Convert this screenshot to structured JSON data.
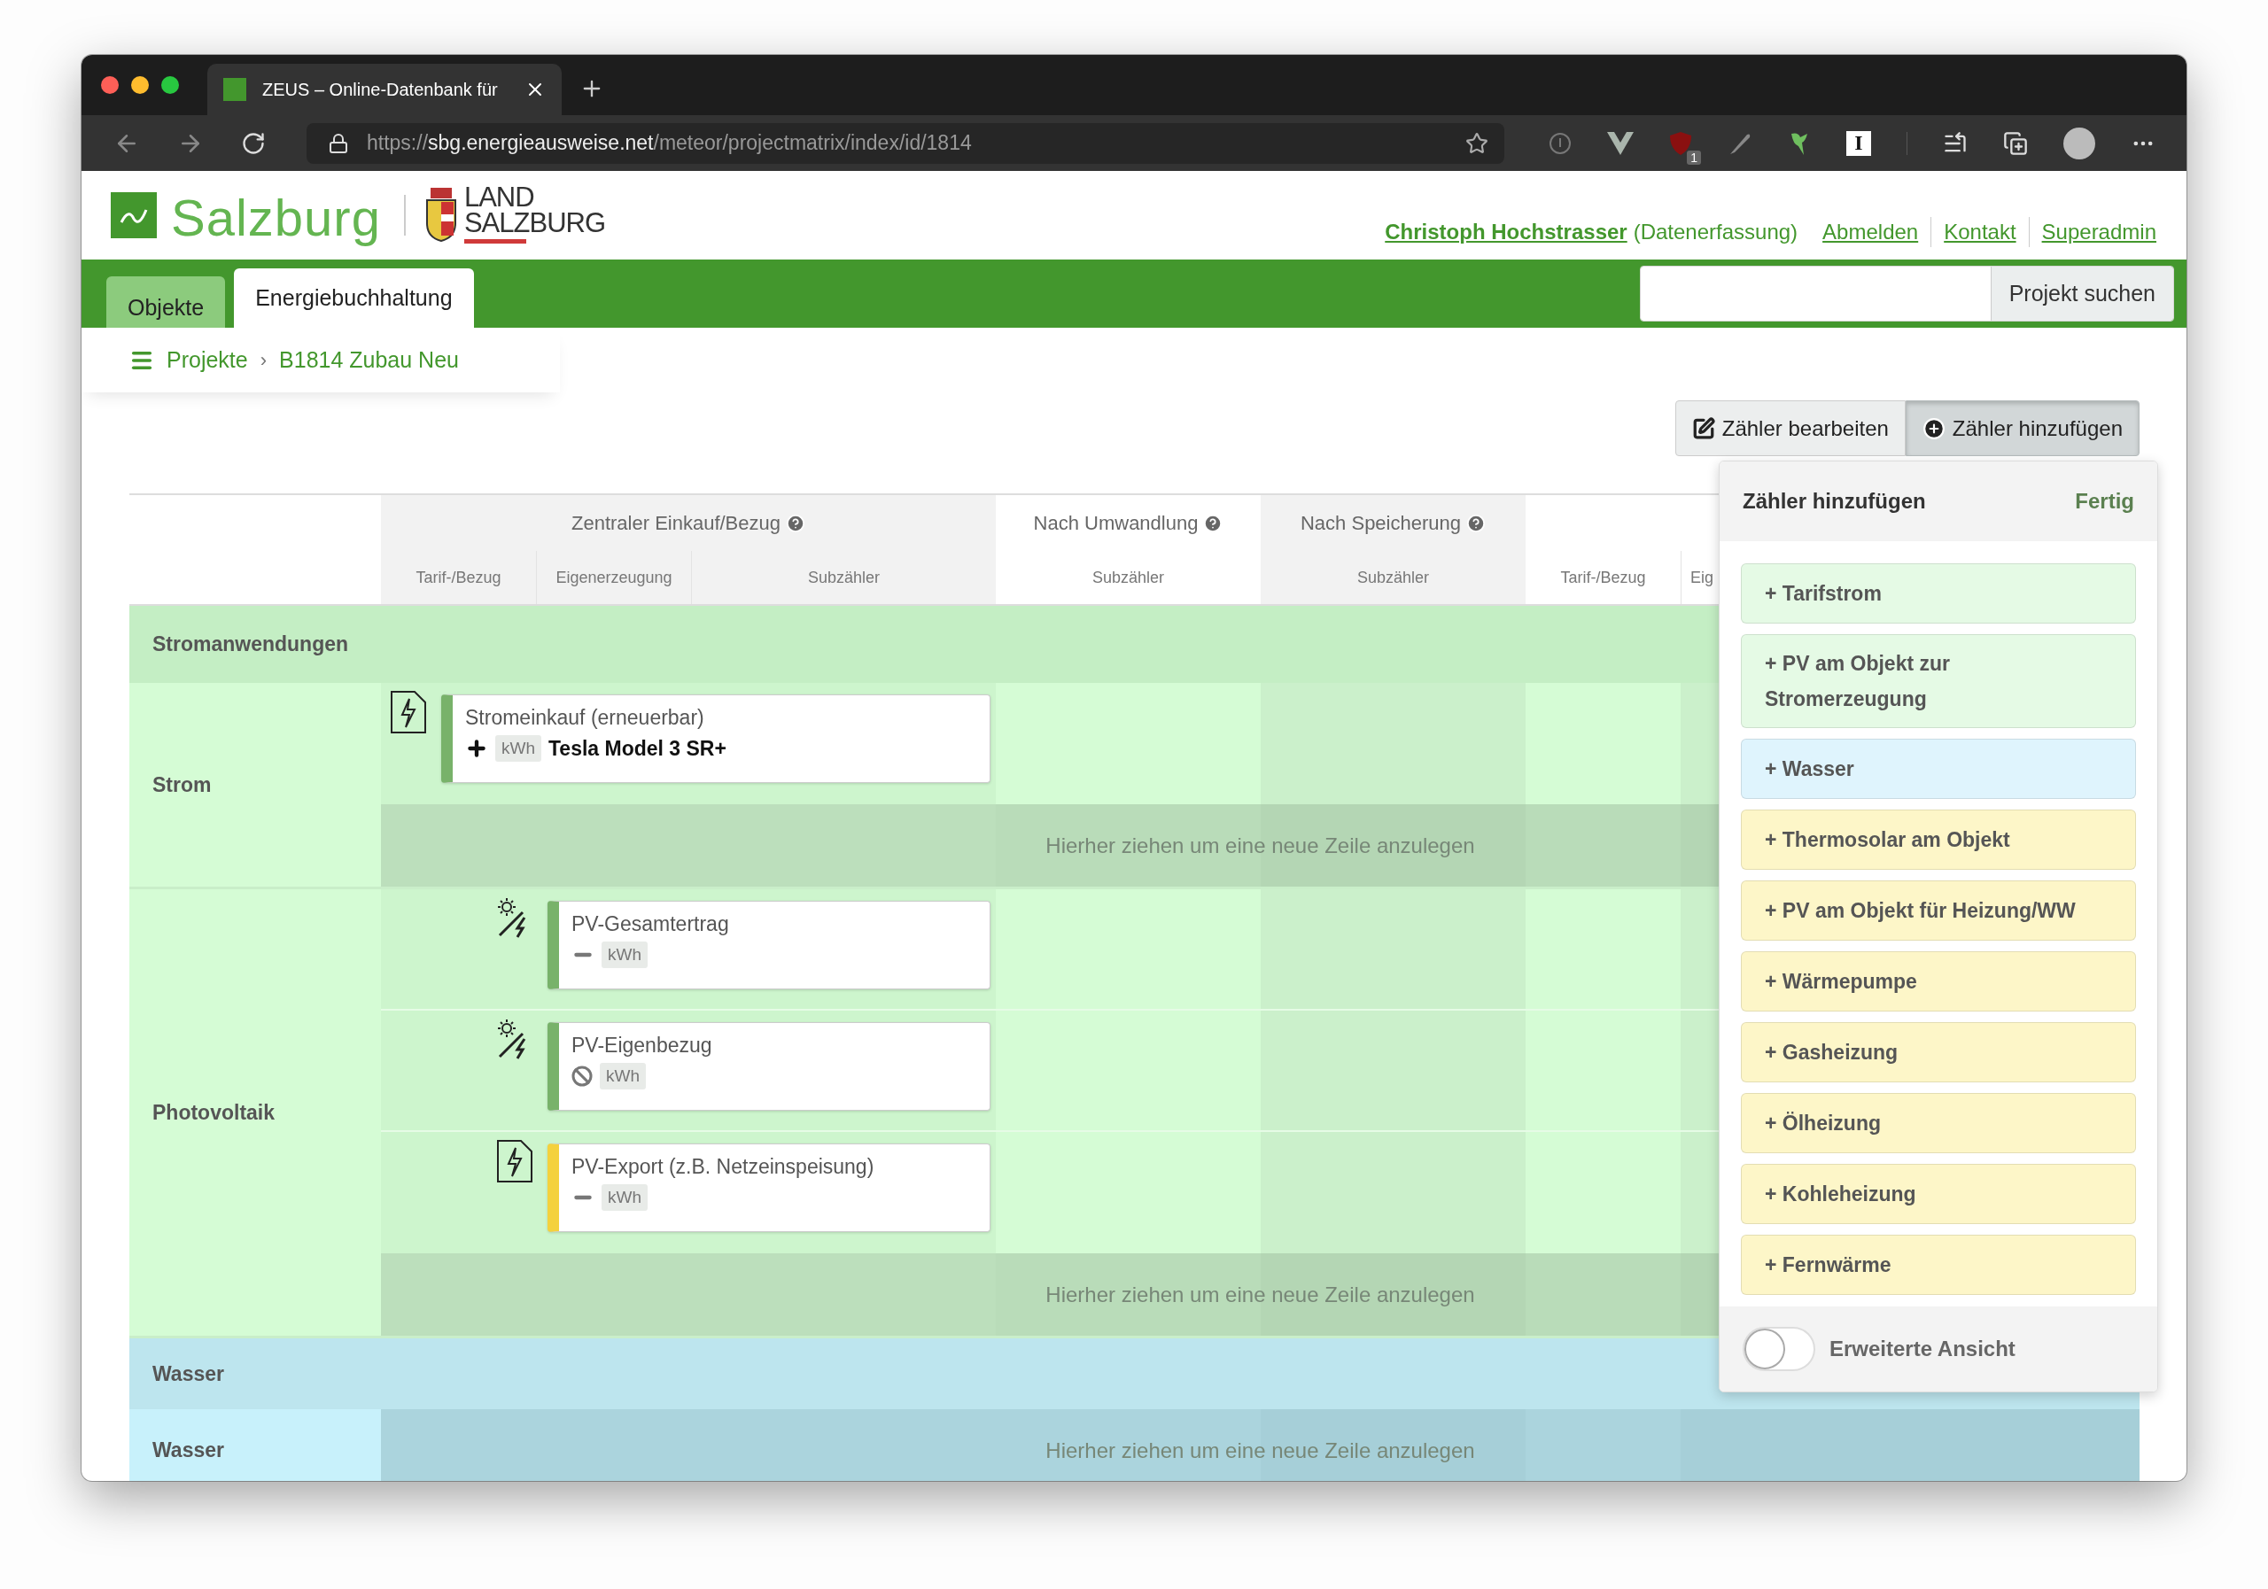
{
  "browser": {
    "tab": {
      "title": "ZEUS – Online-Datenbank für"
    },
    "url": {
      "scheme": "https://",
      "domain": "sbg.energieausweise.net",
      "path": "/meteor/projectmatrix/index/id/1814"
    },
    "extensions": [
      {
        "kind": "info"
      },
      {
        "kind": "vshape"
      },
      {
        "kind": "shield",
        "badge": "1"
      },
      {
        "kind": "pen"
      },
      {
        "kind": "bird"
      },
      {
        "kind": "letter",
        "label": "I"
      }
    ]
  },
  "header": {
    "brand": "Salzburg",
    "land": [
      "LAND",
      "SALZBURG"
    ],
    "user": "Christoph Hochstrasser",
    "role": "(Datenerfassung)",
    "links": [
      "Abmelden",
      "Kontakt",
      "Superadmin"
    ]
  },
  "nav": {
    "tabs": [
      {
        "label": "Objekte",
        "selected": false
      },
      {
        "label": "Energiebuchhaltung",
        "selected": true
      }
    ],
    "search_button": "Projekt suchen"
  },
  "breadcrumb": {
    "items": [
      "Projekte",
      "B1814 Zubau Neu"
    ],
    "separator": "›"
  },
  "actions": [
    {
      "label": "Zähler bearbeiten",
      "kind": "edit",
      "pressed": false
    },
    {
      "label": "Zähler hinzufügen",
      "kind": "add",
      "pressed": true
    }
  ],
  "table": {
    "groups": [
      {
        "label": "Zentraler Einkauf/Bezug",
        "help": true,
        "columns": [
          "Tarif-/Bezug",
          "Eigenerzeugung",
          "Subzähler"
        ]
      },
      {
        "label": "Nach Umwandlung",
        "help": true,
        "columns": [
          "Subzähler"
        ]
      },
      {
        "label": "Nach Speicherung",
        "help": true,
        "columns": [
          "Subzähler"
        ]
      },
      {
        "columns": [
          "Tarif-/Bezug",
          "Eig"
        ]
      }
    ],
    "sections": [
      {
        "title": "Stromanwendungen",
        "kind": "power",
        "rows": [
          {
            "label": "Strom",
            "drop_hint": "Hierher ziehen um eine neue Zeile anzulegen",
            "meters": [
              {
                "name": "Stromeinkauf (erneuerbar)",
                "kind": "purchase",
                "unit": "kWh",
                "title": "Tesla Model 3 SR+",
                "color": "#78b26a"
              }
            ]
          },
          {
            "label": "Photovoltaik",
            "drop_hint": "Hierher ziehen um eine neue Zeile anzulegen",
            "meters": [
              {
                "name": "PV-Gesamtertrag",
                "kind": "yield",
                "unit": "kWh",
                "color": "#78b26a"
              },
              {
                "name": "PV-Eigenbezug",
                "kind": "selfuse",
                "unit": "kWh",
                "color": "#78b26a"
              },
              {
                "name": "PV-Export (z.B. Netzeinspeisung)",
                "kind": "export",
                "unit": "kWh",
                "color": "#f4d13d"
              }
            ]
          }
        ]
      },
      {
        "title": "Wasser",
        "kind": "water",
        "rows": [
          {
            "label": "Wasser",
            "drop_hint": "Hierher ziehen um eine neue Zeile anzulegen",
            "meters": []
          }
        ]
      }
    ]
  },
  "popup": {
    "title": "Zähler hinzufügen",
    "done": "Fertig",
    "items": [
      {
        "label": "+ Tarifstrom",
        "color": "#e5fae5"
      },
      {
        "label": "+ PV am Objekt zur Stromerzeugung",
        "color": "#e5fae5"
      },
      {
        "label": "+ Wasser",
        "color": "#dff4fd"
      },
      {
        "label": "+ Thermosolar am Objekt",
        "color": "#fdf6c8"
      },
      {
        "label": "+ PV am Objekt für Heizung/WW",
        "color": "#fdf6c8"
      },
      {
        "label": "+ Wärmepumpe",
        "color": "#fdf6c8"
      },
      {
        "label": "+ Gasheizung",
        "color": "#fdf6c8"
      },
      {
        "label": "+ Ölheizung",
        "color": "#fdf6c8"
      },
      {
        "label": "+ Kohleheizung",
        "color": "#fdf6c8"
      },
      {
        "label": "+ Fernwärme",
        "color": "#fdf6c8"
      }
    ],
    "toggle": {
      "label": "Erweiterte Ansicht",
      "on": false
    }
  }
}
